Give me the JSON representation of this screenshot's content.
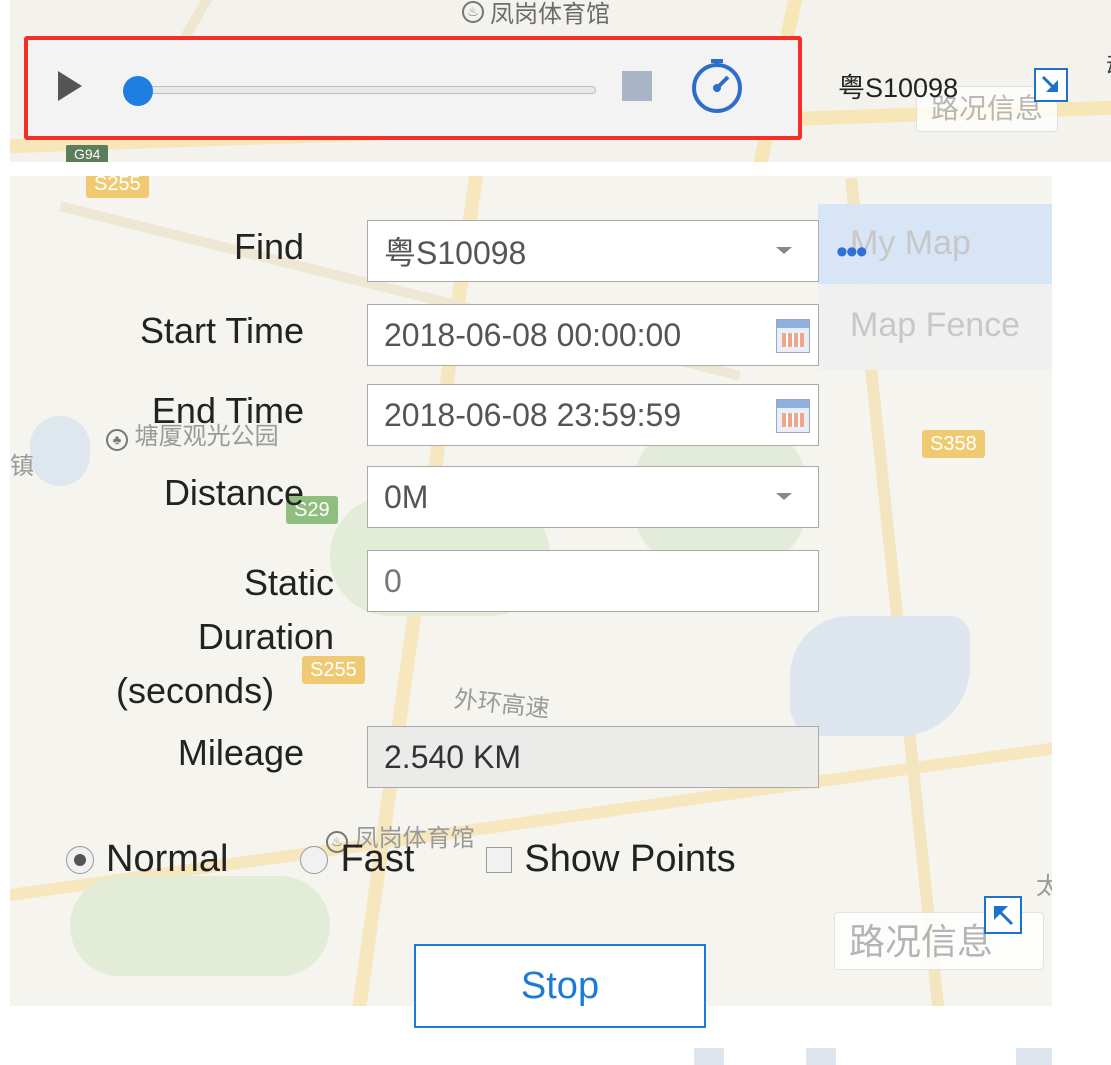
{
  "top_bar": {
    "map_poi": "凤岗体育馆",
    "map_road_badge": "G94",
    "vehicle_plate": "粤S10098",
    "traffic_button": "路况信息",
    "corner_fragment": "动",
    "progress_fraction": 0.03
  },
  "map_layers": {
    "active": "My Map",
    "items": [
      "My Map",
      "Map Fence"
    ]
  },
  "form": {
    "find_label": "Find",
    "find_value": "粤S10098",
    "start_label": "Start Time",
    "start_value": "2018-06-08 00:00:00",
    "end_label": "End Time",
    "end_value": "2018-06-08 23:59:59",
    "distance_label": "Distance",
    "distance_value": "0M",
    "static_label_line1": "Static",
    "static_label_line2": "Duration",
    "static_label_line3": "(seconds)",
    "static_value": "0",
    "mileage_label": "Mileage",
    "mileage_value": "2.540 KM"
  },
  "options": {
    "normal_label": "Normal",
    "fast_label": "Fast",
    "show_points_label": "Show Points",
    "selected_mode": "Normal",
    "show_points_checked": false
  },
  "map_labels": {
    "park": "塘厦观光公园",
    "town": "镇",
    "highway": "外环高速",
    "stadium": "凤岗体育馆",
    "badge_s358": "S358",
    "badge_s29": "S29",
    "badge_s255": "S255",
    "badge_s255_top": "S255",
    "edge_char": "太"
  },
  "traffic_button_lower": "路况信息",
  "stop_button": "Stop",
  "colors": {
    "accent": "#1d7bd6",
    "highlight_border": "#f42f28",
    "progress_knob": "#1e7fe0"
  }
}
